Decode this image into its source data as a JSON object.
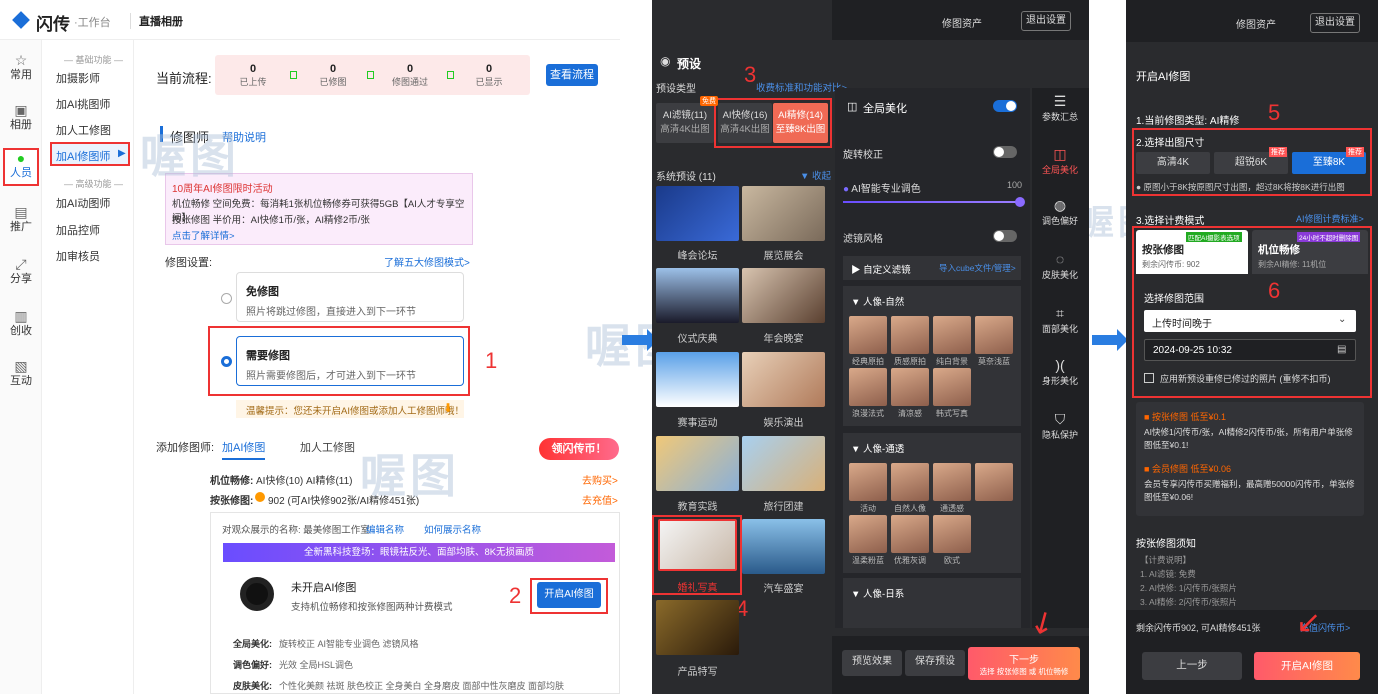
{
  "brand": {
    "name": "闪传",
    "sub": "·工作台",
    "module": "直播相册"
  },
  "nav": [
    {
      "label": "常用",
      "icon": "☆"
    },
    {
      "label": "相册",
      "icon": "▣"
    },
    {
      "label": "人员",
      "icon": "●"
    },
    {
      "label": "推广",
      "icon": "▤"
    },
    {
      "label": "分享",
      "icon": "⤢"
    },
    {
      "label": "创收",
      "icon": "▥"
    },
    {
      "label": "互动",
      "icon": "▧"
    }
  ],
  "subnav": {
    "group1": "— 基础功能 —",
    "items1": [
      "加摄影师",
      "加AI挑图师",
      "加人工修图",
      "加AI修图师"
    ],
    "group2": "— 高级功能 —",
    "items2": [
      "加AI动图师",
      "加品控师",
      "加审核员"
    ]
  },
  "flow": {
    "label": "当前流程:",
    "steps": [
      {
        "n": "0",
        "t": "已上传"
      },
      {
        "n": "0",
        "t": "已修图"
      },
      {
        "n": "0",
        "t": "修图通过"
      },
      {
        "n": "0",
        "t": "已显示"
      }
    ],
    "button": "查看流程"
  },
  "retoucher": {
    "title": "修图师",
    "help": "帮助说明",
    "promo_title": "10周年AI修图限时活动",
    "promo_l1": "机位畅修 空间免费：每消耗1张机位畅修券可获得5GB【AI人才专享空间】",
    "promo_l2": "按张修图 半价用：AI快修1币/张，AI精修2币/张",
    "promo_link": "点击了解详情>",
    "setting_label": "修图设置:",
    "modes_link": "了解五大修图模式>",
    "opt1_title": "免修图",
    "opt1_desc": "照片将跳过修图，直接进入到下一环节",
    "opt2_title": "需要修图",
    "opt2_desc": "照片需要修图后，才可进入到下一环节",
    "tip": "温馨提示：您还未开启AI修图或添加人工修图师哦！"
  },
  "add": {
    "label": "添加修图师:",
    "tab1": "加AI修图",
    "tab2": "加人工修图",
    "badge": "领闪传币！",
    "machine_label": "机位畅修:",
    "machine_val": "AI快修(10) AI精修(11)",
    "buy": "去购买>",
    "perpic_label": "按张修图:",
    "perpic_val": "902 (可AI快修902张/AI精修451张)",
    "recharge": "去充值>",
    "display_name": "对观众展示的名称: 最美修图工作室",
    "edit_name": "编辑名称",
    "how_show": "如何展示名称",
    "banner": "全新黑科技登场：眼镜祛反光、面部均肤、8K无损画质",
    "ai_title": "未开启AI修图",
    "ai_desc": "支持机位畅修和按张修图两种计费模式",
    "ai_btn": "开启AI修图",
    "r1_label": "全局美化:",
    "r1": "旋转校正  AI智能专业调色  滤镜风格",
    "r2_label": "调色偏好:",
    "r2": "光效  全局HSL调色",
    "r3_label": "皮肤美化:",
    "r3": "个性化美颜  祛斑  肤色校正  全身美白  全身磨皮  面部中性灰磨皮  面部均肤"
  },
  "marks": {
    "n1": "1",
    "n2": "2",
    "n3": "3",
    "n4": "4",
    "n5": "5",
    "n6": "6"
  },
  "watermark": "喔图",
  "preset": {
    "assets": "修图资产",
    "exit": "退出设置",
    "title": "预设",
    "type_label": "预设类型",
    "compare": "收费标准和功能对比>",
    "types": [
      {
        "a": "AI滤镜(11)",
        "b": "高清4K出图"
      },
      {
        "a": "AI快修(16)",
        "b": "高清4K出图",
        "tag": "免费"
      },
      {
        "a": "AI精修(14)",
        "b": "至臻8K出图"
      }
    ],
    "sys": "系统预设 (11)",
    "collapse": "收起",
    "thumbs": [
      "峰会论坛",
      "展览展会",
      "仪式庆典",
      "年会晚宴",
      "赛事运动",
      "娱乐演出",
      "教育实践",
      "旅行团建",
      "婚礼写真",
      "汽车盛宴",
      "产品特写"
    ],
    "global": "全局美化",
    "rotate": "旋转校正",
    "ai_color": "AI智能专业调色",
    "ai_val": "100",
    "filter": "滤镜风格",
    "custom_filter": "自定义滤镜",
    "import": "导入cube文件/管理>",
    "g1": "人像-自然",
    "g1_items": [
      "经典原拍",
      "质感原拍",
      "纯白背景",
      "莫奈浅蓝",
      "浪漫法式",
      "清凉感",
      "韩式写真"
    ],
    "g2": "人像-通透",
    "g2_items": [
      "活动",
      "自然人像",
      "通透感",
      "",
      "温柔粉蓝",
      "优雅灰调",
      "欧式"
    ],
    "g3": "人像-日系",
    "side": [
      "参数汇总",
      "全局美化",
      "调色偏好",
      "皮肤美化",
      "面部美化",
      "身形美化",
      "隐私保护"
    ],
    "preview": "预览效果",
    "save": "保存预设",
    "next": "下一步",
    "next_sub": "选择 按张修图 或 机位畅修"
  },
  "open": {
    "assets": "修图资产",
    "exit": "退出设置",
    "title": "开启AI修图",
    "s1": "1.当前修图类型: AI精修",
    "s2": "2.选择出图尺寸",
    "sizes": [
      "高清4K",
      "超锐6K",
      "至臻8K"
    ],
    "tag": "推荐",
    "note": "原图小于8K按原图尺寸出图，超过8K将按8K进行出图",
    "s3": "3.选择计费模式",
    "billing_link": "AI修图计费标准>",
    "pp": "按张修图",
    "pp_tag": "匹配AI摄影表选项",
    "pp_sub": "剩余闪传币: 902",
    "mp": "机位畅修",
    "mp_tag": "24小时不超时删除图",
    "mp_sub": "剩余AI精修: 11机位",
    "range": "选择修图范围",
    "sel": "上传时间晚于",
    "date": "2024-09-25 10:32",
    "chk": "应用新预设重修已修过的照片 (重修不扣币)",
    "p1t": "按张修图 低至¥0.1",
    "p1d": "AI快修1闪传币/张，AI精修2闪传币/张，所有用户单张修图低至¥0.1!",
    "p2t": "会员修图 低至¥0.06",
    "p2d": "会员专享闪传币买赠福利，最高赠50000闪传币，单张修图低至¥0.06!",
    "inst": "按张修图须知",
    "inst_l": [
      "【计费说明】",
      "1. AI滤镜: 免费",
      "2. AI快修: 1闪传币/张照片",
      "3. AI精修: 2闪传币/张照片"
    ],
    "bal": "剩余闪传币902, 可AI精修451张",
    "recharge": "充值闪传币>",
    "prev": "上一步",
    "open_btn": "开启AI修图"
  }
}
